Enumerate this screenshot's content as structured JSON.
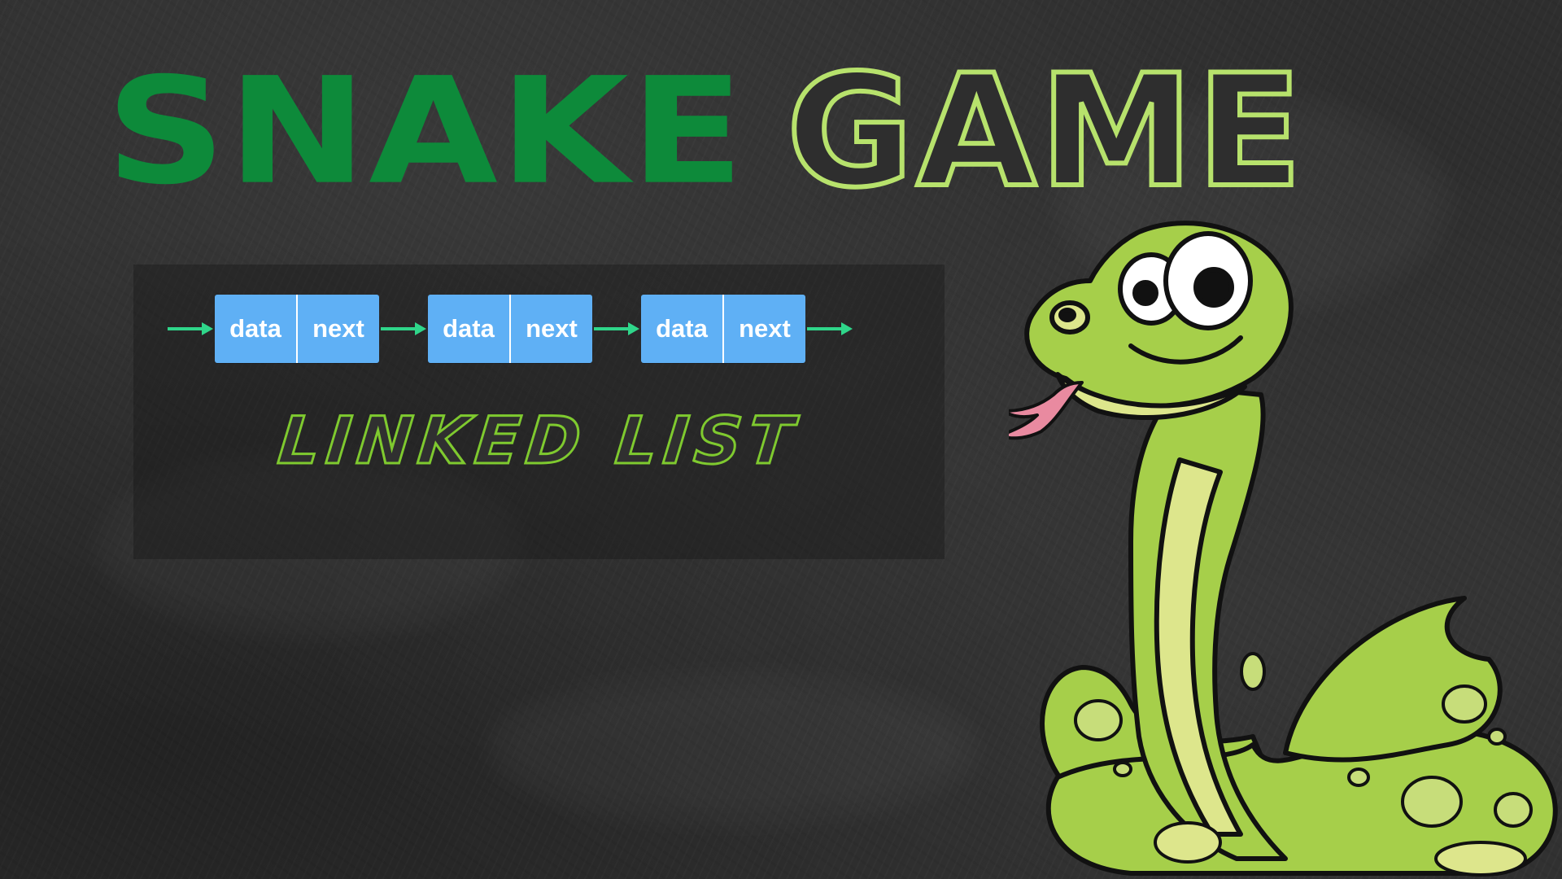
{
  "title": {
    "word1": "SNAKE",
    "word2": "GAME",
    "word1_color": "#0d8a3a",
    "word2_outline_color": "#b7e26c"
  },
  "linked_list": {
    "label": "LINKED LIST",
    "label_outline_color": "#7fca2f",
    "node_color": "#5fb0f5",
    "arrow_color": "#2fd68a",
    "nodes": [
      {
        "data": "data",
        "next": "next"
      },
      {
        "data": "data",
        "next": "next"
      },
      {
        "data": "data",
        "next": "next"
      }
    ]
  },
  "mascot": {
    "icon": "cartoon-snake-icon",
    "body_color": "#a6cf4a",
    "belly_color": "#dde68c"
  },
  "background": {
    "style": "chalkboard",
    "color": "#2e2e2e"
  }
}
